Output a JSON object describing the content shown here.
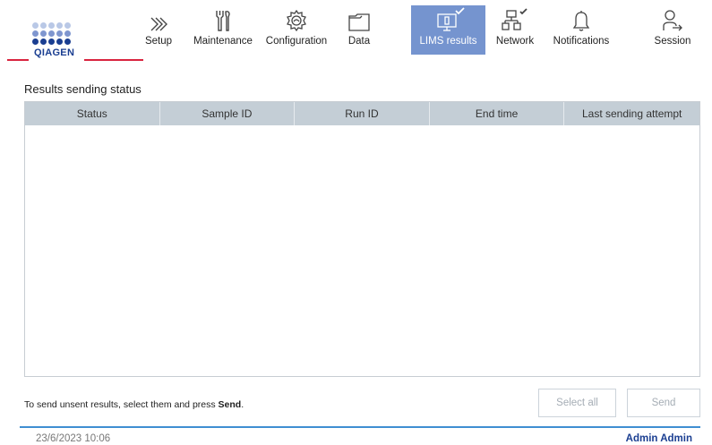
{
  "brand": {
    "logo_text": "QIAGEN",
    "accent_red": "#d9243f",
    "accent_blue": "#1a3e91",
    "active_tab_color": "#7594cf"
  },
  "nav": {
    "setup": {
      "label": "Setup",
      "icon": "chevrons-right-icon"
    },
    "maintenance": {
      "label": "Maintenance",
      "icon": "tools-icon"
    },
    "configuration": {
      "label": "Configuration",
      "icon": "gear-icon"
    },
    "data": {
      "label": "Data",
      "icon": "folder-icon"
    },
    "lims": {
      "label": "LIMS results",
      "icon": "monitor-check-icon",
      "active": true
    },
    "network": {
      "label": "Network",
      "icon": "network-check-icon"
    },
    "notifications": {
      "label": "Notifications",
      "icon": "bell-icon"
    },
    "session": {
      "label": "Session",
      "icon": "user-logout-icon"
    }
  },
  "main": {
    "title": "Results sending status",
    "table": {
      "columns": [
        "Status",
        "Sample ID",
        "Run ID",
        "End time",
        "Last sending attempt"
      ],
      "rows": []
    }
  },
  "footer": {
    "hint_prefix": "To send unsent results, select them and press ",
    "hint_bold": "Send",
    "hint_suffix": ".",
    "select_all_label": "Select all",
    "send_label": "Send"
  },
  "status_bar": {
    "datetime": "23/6/2023 10:06",
    "user": "Admin Admin"
  }
}
